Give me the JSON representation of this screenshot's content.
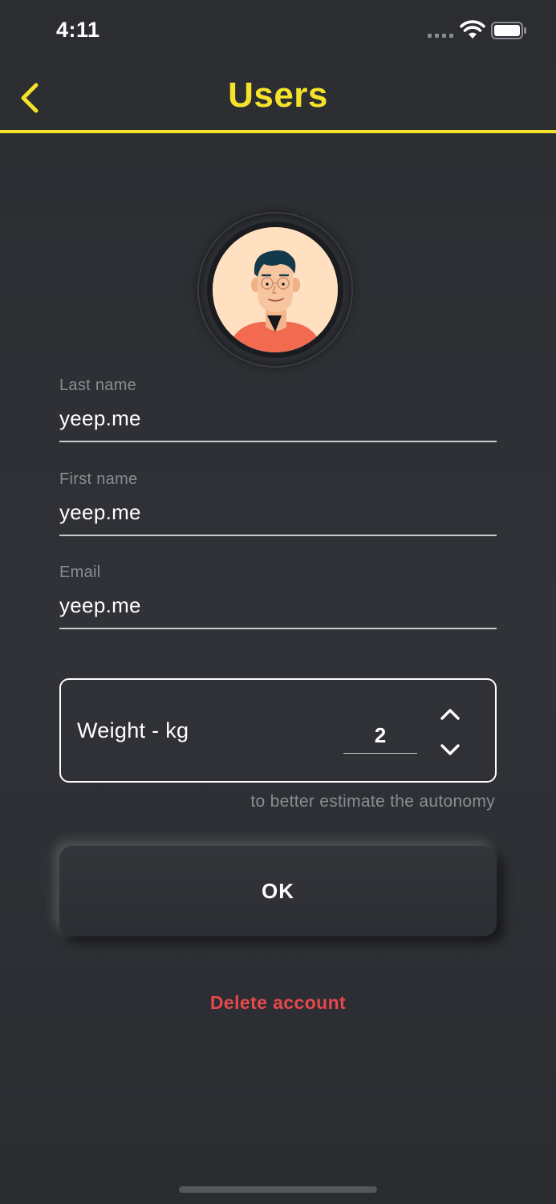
{
  "status_bar": {
    "time": "4:11"
  },
  "nav": {
    "title": "Users",
    "back_icon": "chevron-left-icon",
    "accent_color": "#f5e22a"
  },
  "avatar": {
    "icon": "user-avatar-illustration"
  },
  "form": {
    "last_name": {
      "label": "Last name",
      "value": "yeep.me"
    },
    "first_name": {
      "label": "First name",
      "value": "yeep.me"
    },
    "email": {
      "label": "Email",
      "value": "yeep.me"
    },
    "weight": {
      "label": "Weight - kg",
      "value": "2",
      "hint": "to better estimate the autonomy",
      "increment_icon": "chevron-up-icon",
      "decrement_icon": "chevron-down-icon"
    }
  },
  "actions": {
    "ok_label": "OK",
    "delete_label": "Delete account",
    "delete_color": "#e5484d"
  }
}
